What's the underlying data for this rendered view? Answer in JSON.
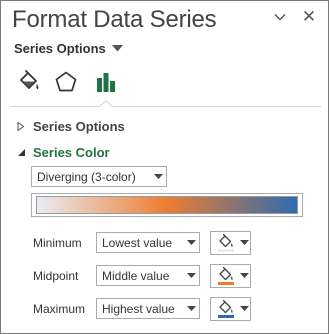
{
  "pane": {
    "title": "Format Data Series",
    "close_glyph": "✕",
    "options_dropdown": "Series Options"
  },
  "tabs": [
    {
      "icon": "fill-line-icon"
    },
    {
      "icon": "effects-icon"
    },
    {
      "icon": "series-options-chart-icon",
      "selected": true
    }
  ],
  "sections": {
    "series_options": {
      "label": "Series Options",
      "expanded": false
    },
    "series_color": {
      "label": "Series Color",
      "expanded": true
    }
  },
  "color_type": {
    "value": "Diverging (3-color)"
  },
  "gradient": {
    "colors": [
      "#e9edf5",
      "#ed7d31",
      "#2e6bb0"
    ]
  },
  "rows": [
    {
      "label": "Minimum",
      "value": "Lowest value",
      "swatch": "#e9edf5"
    },
    {
      "label": "Midpoint",
      "value": "Middle value",
      "swatch": "#ed7d31"
    },
    {
      "label": "Maximum",
      "value": "Highest value",
      "swatch": "#2e6bb0"
    }
  ],
  "colors": {
    "accent_green": "#217346",
    "border": "#ababab"
  }
}
